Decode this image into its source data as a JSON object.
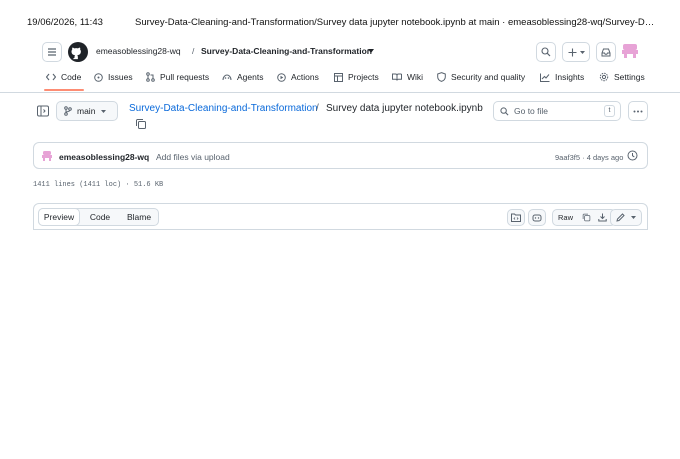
{
  "print_header": {
    "datetime": "19/06/2026, 11:43",
    "title": "Survey-Data-Cleaning-and-Transformation/Survey data jupyter notebook.ipynb at main · emeasoblessing28-wq/Survey-Dat..."
  },
  "topbar": {
    "owner": "emeasoblessing28-wq",
    "separator": "/",
    "repo": "Survey-Data-Cleaning-and-Transformation",
    "icons": [
      "menu-icon",
      "github-logo",
      "search-icon",
      "plus-icon",
      "inbox-icon",
      "avatar"
    ]
  },
  "tabs": [
    {
      "label": "Code",
      "icon": "code-icon",
      "selected": true
    },
    {
      "label": "Issues",
      "icon": "issue-icon"
    },
    {
      "label": "Pull requests",
      "icon": "pull-request-icon"
    },
    {
      "label": "Agents",
      "icon": "agents-icon"
    },
    {
      "label": "Actions",
      "icon": "play-icon"
    },
    {
      "label": "Projects",
      "icon": "table-icon"
    },
    {
      "label": "Wiki",
      "icon": "book-icon"
    },
    {
      "label": "Security and quality",
      "icon": "shield-icon"
    },
    {
      "label": "Insights",
      "icon": "graph-icon"
    },
    {
      "label": "Settings",
      "icon": "gear-icon"
    }
  ],
  "breadcrumb": {
    "branch": "main",
    "repo": "Survey-Data-Cleaning-and-Transformation",
    "separator": "/",
    "file": "Survey data jupyter notebook.ipynb"
  },
  "goto_file": {
    "placeholder": "Go to file",
    "shortcut": "t"
  },
  "commit": {
    "author": "emeasoblessing28-wq",
    "message": "Add files via upload",
    "meta": "9aaf3f5 · 4 days ago"
  },
  "file_info": "1411 lines (1411 loc) · 51.6 KB",
  "file_header": {
    "views": [
      "Preview",
      "Code",
      "Blame"
    ],
    "active_view": "Preview",
    "raw_label": "Raw"
  },
  "colors": {
    "link": "#0969da",
    "border": "#d1d9e0",
    "muted": "#59636e",
    "selected_tab_underline": "#fd8c73",
    "avatar": "#e7a3d6"
  }
}
